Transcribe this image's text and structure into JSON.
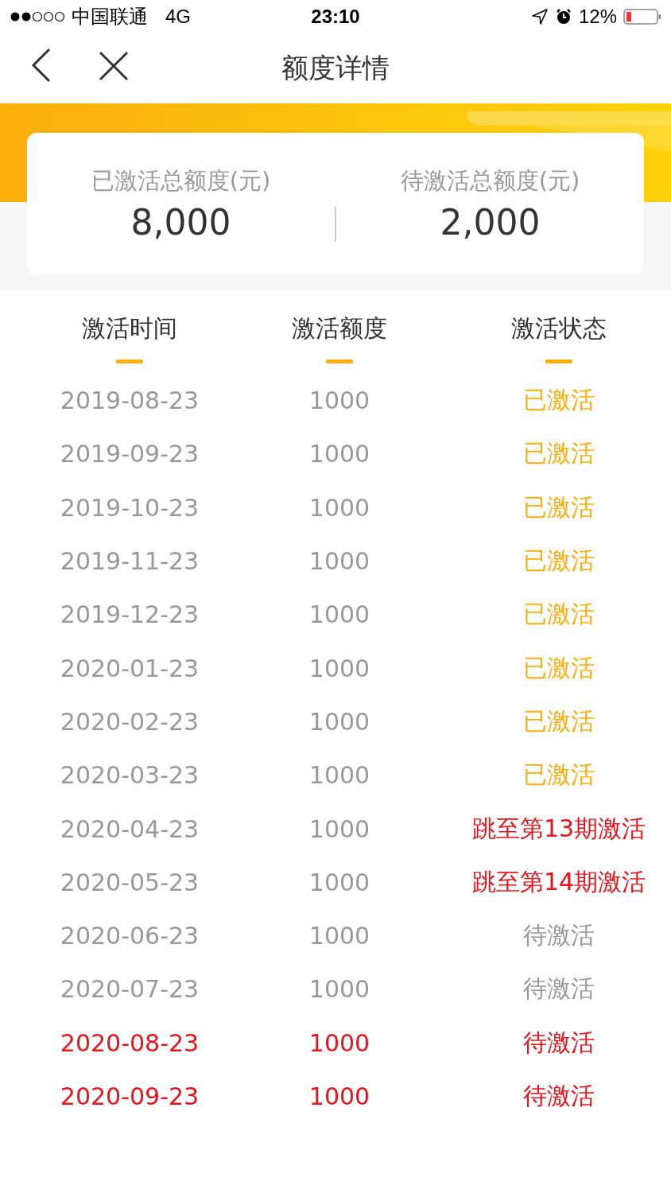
{
  "status_bar": {
    "carrier": "中国联通",
    "network": "4G",
    "time": "23:10",
    "battery": "12%"
  },
  "nav": {
    "title": "额度详情"
  },
  "summary": [
    {
      "label": "已激活总额度(元)",
      "value": "8,000"
    },
    {
      "label": "待激活总额度(元)",
      "value": "2,000"
    }
  ],
  "table": {
    "columns": [
      "激活时间",
      "激活额度",
      "激活状态"
    ],
    "rows": [
      {
        "date": "2019-08-23",
        "amount": "1000",
        "status": "已激活",
        "kind": "activated",
        "highlight": false
      },
      {
        "date": "2019-09-23",
        "amount": "1000",
        "status": "已激活",
        "kind": "activated",
        "highlight": false
      },
      {
        "date": "2019-10-23",
        "amount": "1000",
        "status": "已激活",
        "kind": "activated",
        "highlight": false
      },
      {
        "date": "2019-11-23",
        "amount": "1000",
        "status": "已激活",
        "kind": "activated",
        "highlight": false
      },
      {
        "date": "2019-12-23",
        "amount": "1000",
        "status": "已激活",
        "kind": "activated",
        "highlight": false
      },
      {
        "date": "2020-01-23",
        "amount": "1000",
        "status": "已激活",
        "kind": "activated",
        "highlight": false
      },
      {
        "date": "2020-02-23",
        "amount": "1000",
        "status": "已激活",
        "kind": "activated",
        "highlight": false
      },
      {
        "date": "2020-03-23",
        "amount": "1000",
        "status": "已激活",
        "kind": "activated",
        "highlight": false
      },
      {
        "date": "2020-04-23",
        "amount": "1000",
        "status": "跳至第13期激活",
        "kind": "skipped",
        "highlight": false
      },
      {
        "date": "2020-05-23",
        "amount": "1000",
        "status": "跳至第14期激活",
        "kind": "skipped",
        "highlight": false
      },
      {
        "date": "2020-06-23",
        "amount": "1000",
        "status": "待激活",
        "kind": "pending",
        "highlight": false
      },
      {
        "date": "2020-07-23",
        "amount": "1000",
        "status": "待激活",
        "kind": "pending",
        "highlight": false
      },
      {
        "date": "2020-08-23",
        "amount": "1000",
        "status": "待激活",
        "kind": "pending",
        "highlight": true
      },
      {
        "date": "2020-09-23",
        "amount": "1000",
        "status": "待激活",
        "kind": "pending",
        "highlight": true
      }
    ]
  }
}
